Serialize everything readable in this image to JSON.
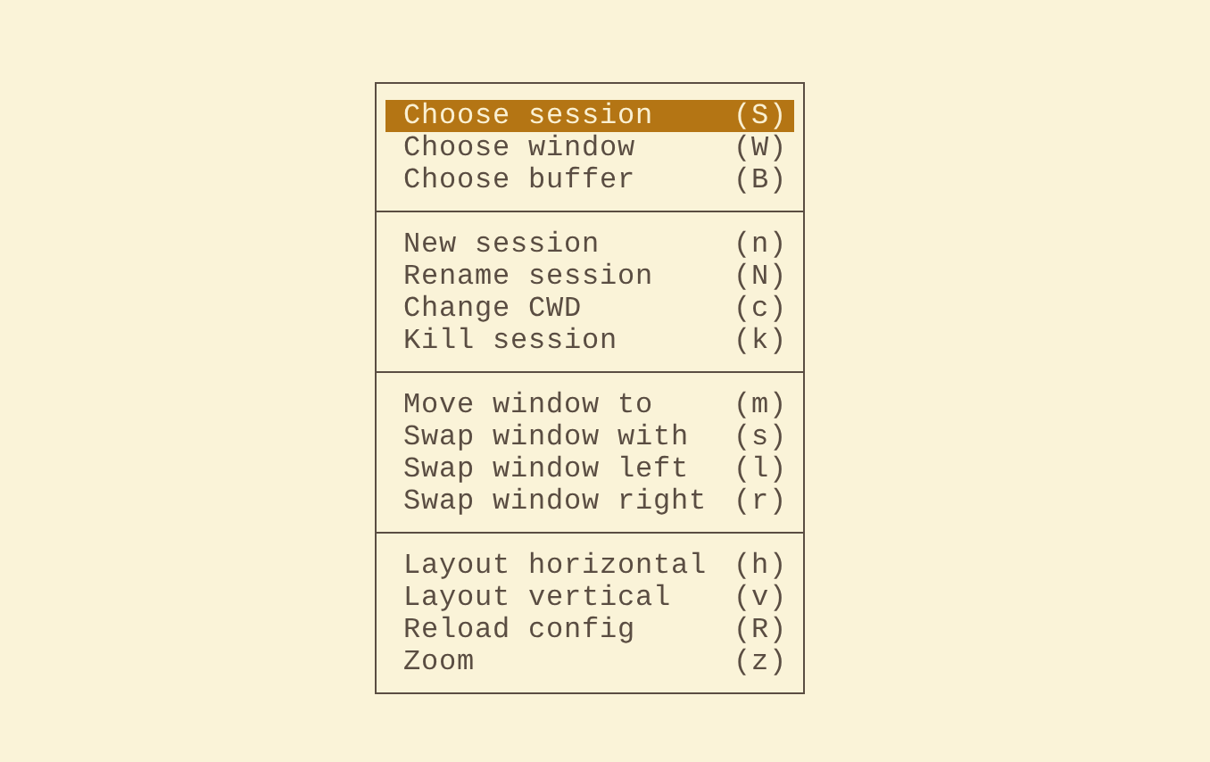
{
  "menu": {
    "sections": [
      {
        "items": [
          {
            "label": "Choose session",
            "key": "(S)",
            "selected": true
          },
          {
            "label": "Choose window",
            "key": "(W)",
            "selected": false
          },
          {
            "label": "Choose buffer",
            "key": "(B)",
            "selected": false
          }
        ]
      },
      {
        "items": [
          {
            "label": "New session",
            "key": "(n)",
            "selected": false
          },
          {
            "label": "Rename session",
            "key": "(N)",
            "selected": false
          },
          {
            "label": "Change CWD",
            "key": "(c)",
            "selected": false
          },
          {
            "label": "Kill session",
            "key": "(k)",
            "selected": false
          }
        ]
      },
      {
        "items": [
          {
            "label": "Move window to",
            "key": "(m)",
            "selected": false
          },
          {
            "label": "Swap window with",
            "key": "(s)",
            "selected": false
          },
          {
            "label": "Swap window left",
            "key": "(l)",
            "selected": false
          },
          {
            "label": "Swap window right",
            "key": "(r)",
            "selected": false
          }
        ]
      },
      {
        "items": [
          {
            "label": "Layout horizontal",
            "key": "(h)",
            "selected": false
          },
          {
            "label": "Layout vertical",
            "key": "(v)",
            "selected": false
          },
          {
            "label": "Reload config",
            "key": "(R)",
            "selected": false
          },
          {
            "label": "Zoom",
            "key": "(z)",
            "selected": false
          }
        ]
      }
    ]
  }
}
